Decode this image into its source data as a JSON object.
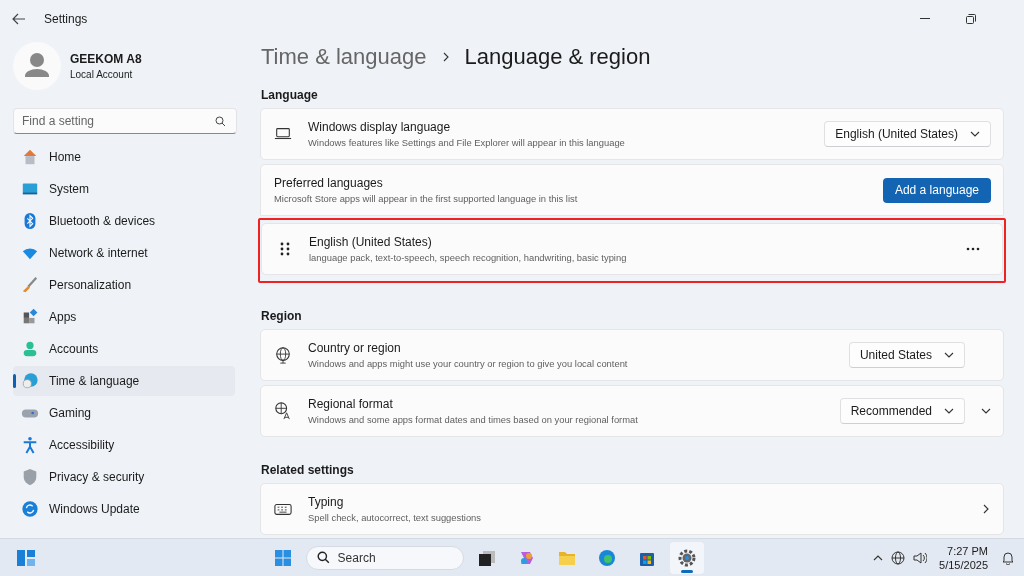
{
  "window": {
    "title": "Settings"
  },
  "account": {
    "name": "GEEKOM A8",
    "type": "Local Account"
  },
  "search": {
    "placeholder": "Find a setting"
  },
  "nav": [
    {
      "label": "Home",
      "selected": false
    },
    {
      "label": "System",
      "selected": false
    },
    {
      "label": "Bluetooth & devices",
      "selected": false
    },
    {
      "label": "Network & internet",
      "selected": false
    },
    {
      "label": "Personalization",
      "selected": false
    },
    {
      "label": "Apps",
      "selected": false
    },
    {
      "label": "Accounts",
      "selected": false
    },
    {
      "label": "Time & language",
      "selected": true
    },
    {
      "label": "Gaming",
      "selected": false
    },
    {
      "label": "Accessibility",
      "selected": false
    },
    {
      "label": "Privacy & security",
      "selected": false
    },
    {
      "label": "Windows Update",
      "selected": false
    }
  ],
  "breadcrumb": {
    "parent": "Time & language",
    "current": "Language & region"
  },
  "sections": [
    {
      "heading": "Language",
      "cards": [
        {
          "kind": "dropdown",
          "title": "Windows display language",
          "description": "Windows features like Settings and File Explorer will appear in this language",
          "value": "English (United States)"
        },
        {
          "kind": "button",
          "title": "Preferred languages",
          "description": "Microsoft Store apps will appear in the first supported language in this list",
          "button": "Add a language"
        },
        {
          "kind": "language",
          "title": "English (United States)",
          "description": "language pack, text-to-speech, speech recognition, handwriting, basic typing",
          "highlighted": true
        }
      ]
    },
    {
      "heading": "Region",
      "cards": [
        {
          "kind": "dropdown",
          "title": "Country or region",
          "description": "Windows and apps might use your country or region to give you local content",
          "value": "United States"
        },
        {
          "kind": "dropdown",
          "title": "Regional format",
          "description": "Windows and some apps format dates and times based on your regional format",
          "value": "Recommended",
          "expanded": false
        }
      ]
    },
    {
      "heading": "Related settings",
      "cards": [
        {
          "kind": "link",
          "title": "Typing",
          "description": "Spell check, autocorrect, text suggestions"
        }
      ]
    }
  ],
  "taskbar": {
    "search_placeholder": "Search",
    "apps": [
      {
        "selected": false
      },
      {
        "selected": false
      },
      {
        "selected": false
      },
      {
        "selected": false
      },
      {
        "selected": false
      },
      {
        "selected": false
      },
      {
        "selected": true
      }
    ],
    "time": "7:27 PM",
    "date": "5/15/2025"
  }
}
